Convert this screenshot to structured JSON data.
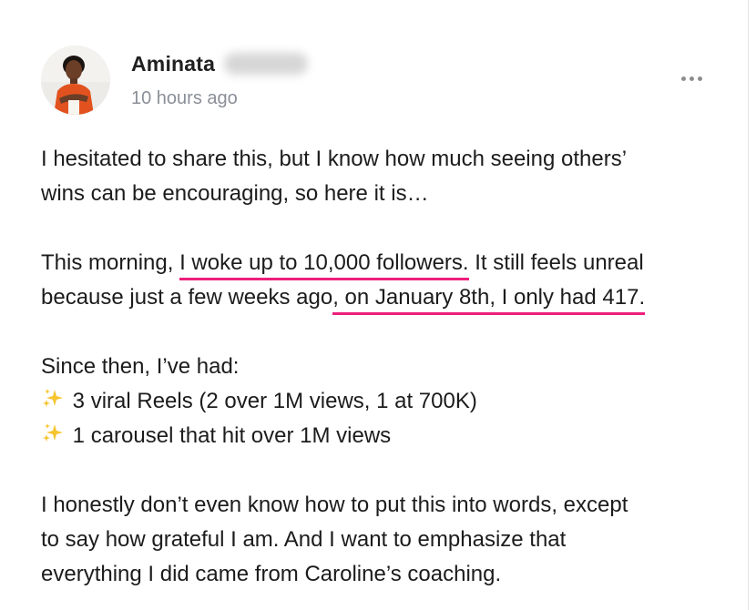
{
  "post": {
    "author": {
      "first_name": "Aminata"
    },
    "timestamp": "10 hours ago",
    "icons": {
      "avatar": "profile-photo",
      "menu": "more-options-icon",
      "bullet": "sparkles-emoji"
    },
    "highlight_color": "#ee1e7d",
    "paragraphs": {
      "p1_line1": "I hesitated to share this, but I know how much seeing others’",
      "p1_line2": "wins can be encouraging, so here it is…",
      "p2_line1_pre": "This morning,",
      "p2_line1_highlight": "I woke up to 10,000 followers.",
      "p2_line1_post": "It still feels unreal",
      "p2_line2_pre": "because just a few weeks ago",
      "p2_line2_highlight": ", on January 8th, I only had 417.",
      "p3_intro": "Since then, I’ve had:",
      "p3_item1": "3 viral Reels (2 over 1M views, 1 at 700K)",
      "p3_item2": "1 carousel that hit over 1M views",
      "p4_line1": "I honestly don’t even know how to put this into words, except",
      "p4_line2": "to say how grateful I am. And I want to emphasize that",
      "p4_line3": "everything I did came from Caroline’s coaching."
    }
  }
}
